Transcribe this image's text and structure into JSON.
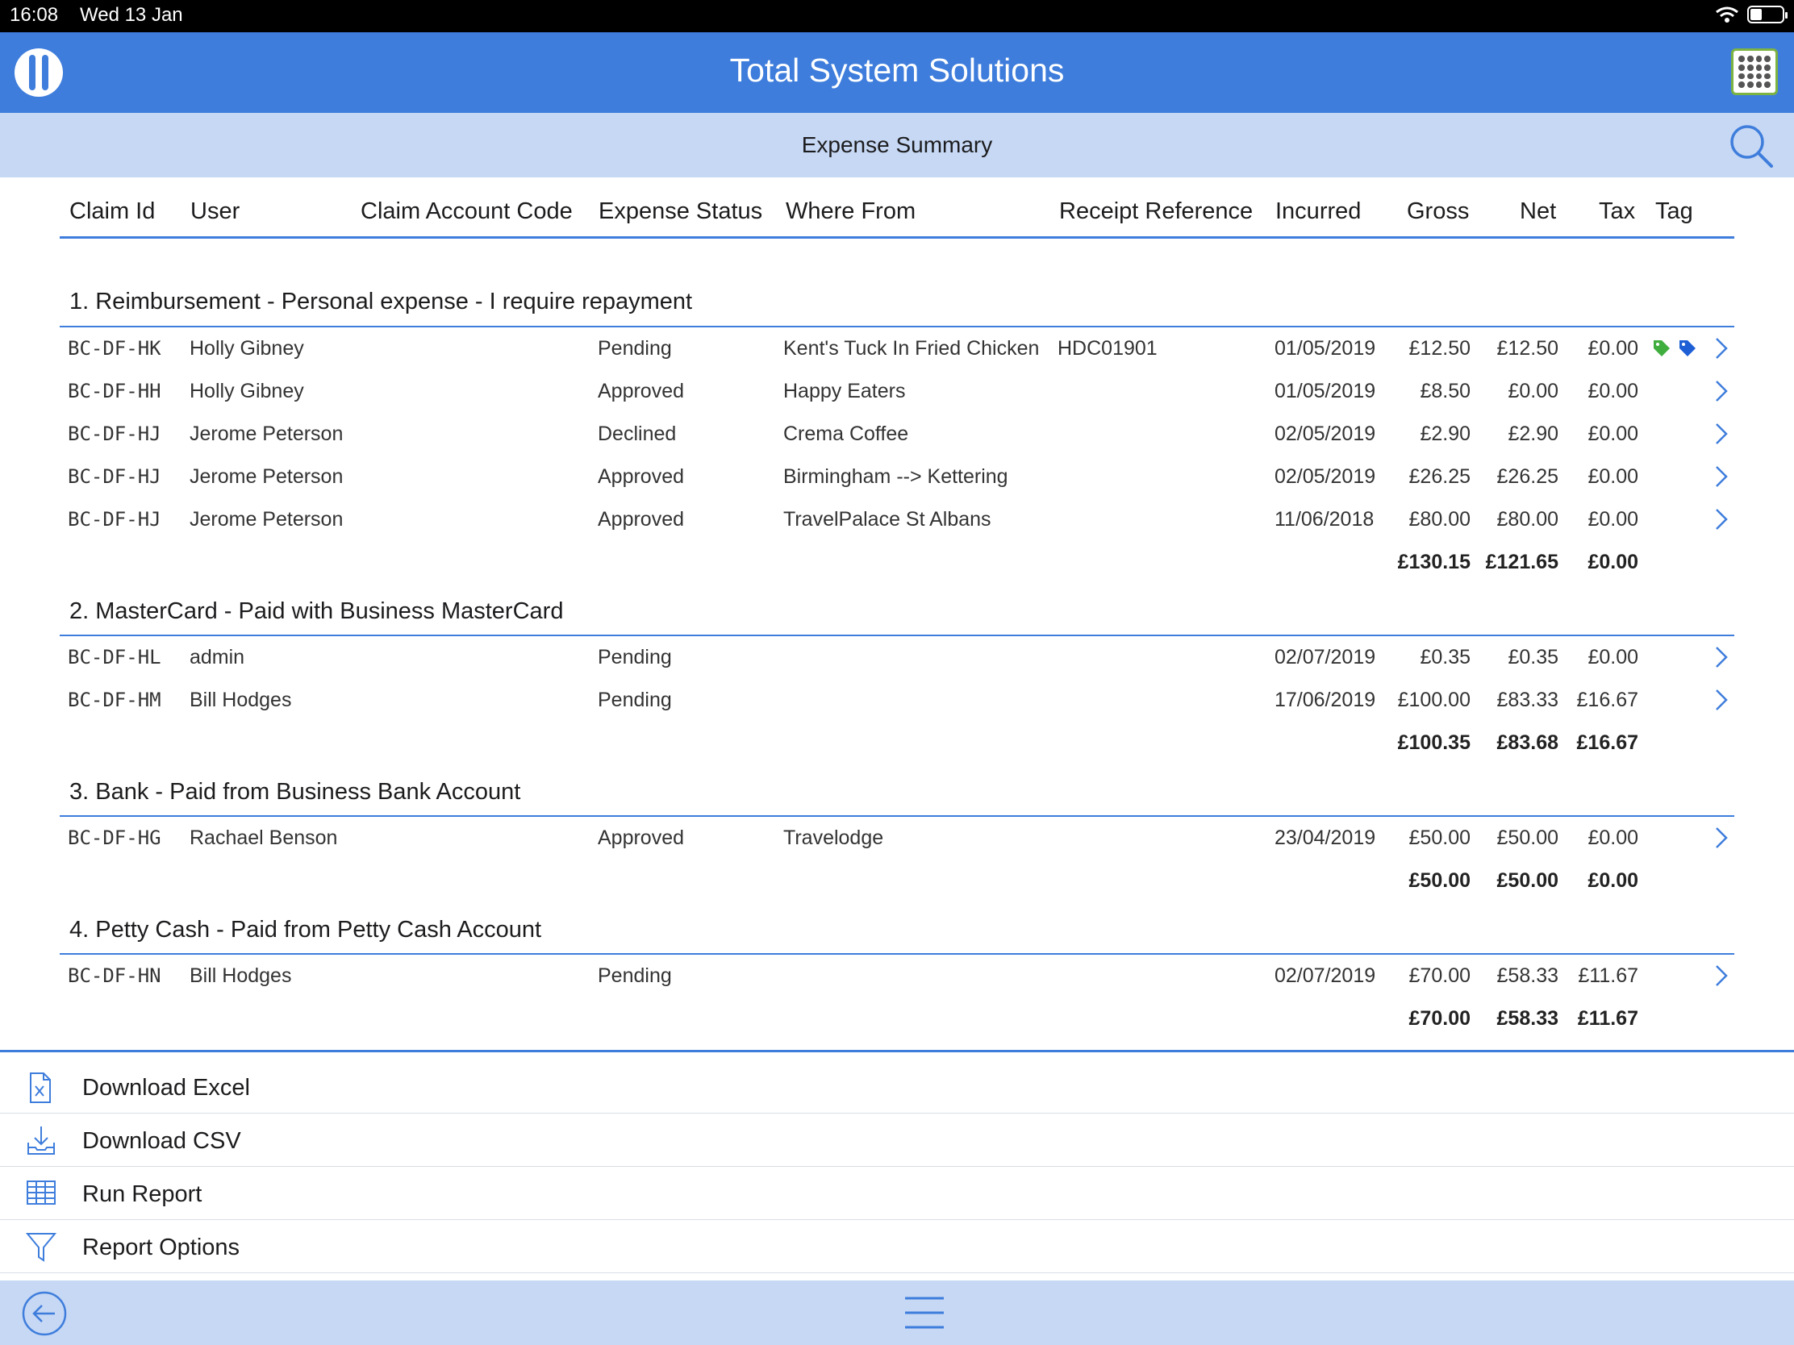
{
  "status_bar": {
    "time": "16:08",
    "date": "Wed 13 Jan"
  },
  "header": {
    "title": "Total System Solutions"
  },
  "subheader": {
    "title": "Expense Summary"
  },
  "columns": [
    "Claim Id",
    "User",
    "Claim Account Code",
    "Expense Status",
    "Where From",
    "Receipt Reference",
    "Incurred",
    "Gross",
    "Net",
    "Tax",
    "Tag"
  ],
  "sections": [
    {
      "title": "1. Reimbursement - Personal expense - I require repayment",
      "rows": [
        {
          "claim_id": "BC-DF-HK",
          "user": "Holly Gibney",
          "status": "Pending",
          "where_from": "Kent's Tuck In Fried Chicken",
          "receipt": "HDC01901",
          "incurred": "01/05/2019",
          "gross": "£12.50",
          "net": "£12.50",
          "tax": "£0.00",
          "tags": [
            "green-tag",
            "blue-tag"
          ]
        },
        {
          "claim_id": "BC-DF-HH",
          "user": "Holly Gibney",
          "status": "Approved",
          "where_from": "Happy Eaters",
          "receipt": "",
          "incurred": "01/05/2019",
          "gross": "£8.50",
          "net": "£0.00",
          "tax": "£0.00",
          "tags": []
        },
        {
          "claim_id": "BC-DF-HJ",
          "user": "Jerome Peterson",
          "status": "Declined",
          "where_from": "Crema Coffee",
          "receipt": "",
          "incurred": "02/05/2019",
          "gross": "£2.90",
          "net": "£2.90",
          "tax": "£0.00",
          "tags": []
        },
        {
          "claim_id": "BC-DF-HJ",
          "user": "Jerome Peterson",
          "status": "Approved",
          "where_from": "Birmingham --> Kettering",
          "receipt": "",
          "incurred": "02/05/2019",
          "gross": "£26.25",
          "net": "£26.25",
          "tax": "£0.00",
          "tags": []
        },
        {
          "claim_id": "BC-DF-HJ",
          "user": "Jerome Peterson",
          "status": "Approved",
          "where_from": "TravelPalace St Albans",
          "receipt": "",
          "incurred": "11/06/2018",
          "gross": "£80.00",
          "net": "£80.00",
          "tax": "£0.00",
          "tags": []
        }
      ],
      "totals": {
        "gross": "£130.15",
        "net": "£121.65",
        "tax": "£0.00"
      }
    },
    {
      "title": "2. MasterCard - Paid with Business MasterCard",
      "rows": [
        {
          "claim_id": "BC-DF-HL",
          "user": "admin",
          "status": "Pending",
          "where_from": "",
          "receipt": "",
          "incurred": "02/07/2019",
          "gross": "£0.35",
          "net": "£0.35",
          "tax": "£0.00",
          "tags": []
        },
        {
          "claim_id": "BC-DF-HM",
          "user": "Bill Hodges",
          "status": "Pending",
          "where_from": "",
          "receipt": "",
          "incurred": "17/06/2019",
          "gross": "£100.00",
          "net": "£83.33",
          "tax": "£16.67",
          "tags": []
        }
      ],
      "totals": {
        "gross": "£100.35",
        "net": "£83.68",
        "tax": "£16.67"
      }
    },
    {
      "title": "3. Bank - Paid from Business Bank Account",
      "rows": [
        {
          "claim_id": "BC-DF-HG",
          "user": "Rachael Benson",
          "status": "Approved",
          "where_from": "Travelodge",
          "receipt": "",
          "incurred": "23/04/2019",
          "gross": "£50.00",
          "net": "£50.00",
          "tax": "£0.00",
          "tags": []
        }
      ],
      "totals": {
        "gross": "£50.00",
        "net": "£50.00",
        "tax": "£0.00"
      }
    },
    {
      "title": "4. Petty Cash - Paid from Petty Cash Account",
      "rows": [
        {
          "claim_id": "BC-DF-HN",
          "user": "Bill Hodges",
          "status": "Pending",
          "where_from": "",
          "receipt": "",
          "incurred": "02/07/2019",
          "gross": "£70.00",
          "net": "£58.33",
          "tax": "£11.67",
          "tags": []
        }
      ],
      "totals": {
        "gross": "£70.00",
        "net": "£58.33",
        "tax": "£11.67"
      }
    }
  ],
  "actions": [
    {
      "label": "Download Excel",
      "icon": "excel-file-icon"
    },
    {
      "label": "Download CSV",
      "icon": "download-tray-icon"
    },
    {
      "label": "Run Report",
      "icon": "table-grid-icon"
    },
    {
      "label": "Report Options",
      "icon": "filter-funnel-icon"
    }
  ],
  "colors": {
    "brand": "#3e7ddc",
    "subheader": "#c6d8f4",
    "tag_green": "#3fae3f",
    "tag_blue": "#1e5fd6"
  }
}
